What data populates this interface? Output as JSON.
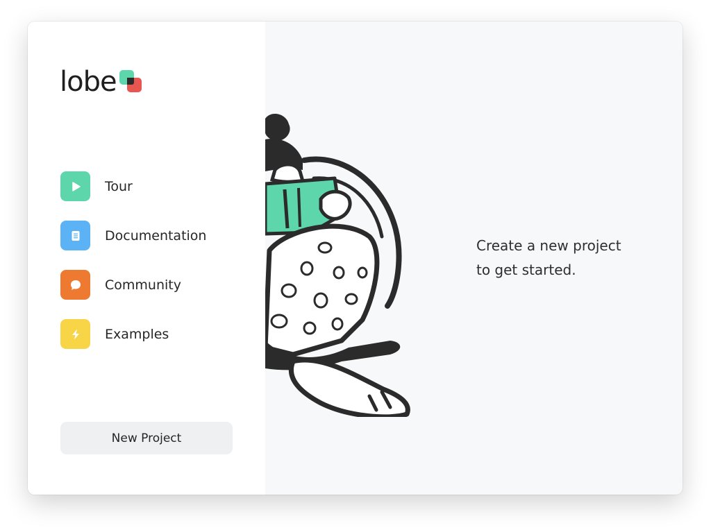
{
  "app": {
    "logo_text": "lobe"
  },
  "sidebar": {
    "items": [
      {
        "label": "Tour",
        "icon": "play-icon",
        "color": "#5dd6ac"
      },
      {
        "label": "Documentation",
        "icon": "document-icon",
        "color": "#5bb3f5"
      },
      {
        "label": "Community",
        "icon": "chat-bubble-icon",
        "color": "#ee7a32"
      },
      {
        "label": "Examples",
        "icon": "lightning-icon",
        "color": "#f8d547"
      }
    ],
    "new_project_label": "New Project"
  },
  "main": {
    "prompt_line1": "Create a new project",
    "prompt_line2": "to get started."
  },
  "colors": {
    "accent_green": "#5dd6ac",
    "accent_red": "#e85652",
    "sidebar_bg": "#ffffff",
    "main_bg": "#f7f8fa"
  }
}
